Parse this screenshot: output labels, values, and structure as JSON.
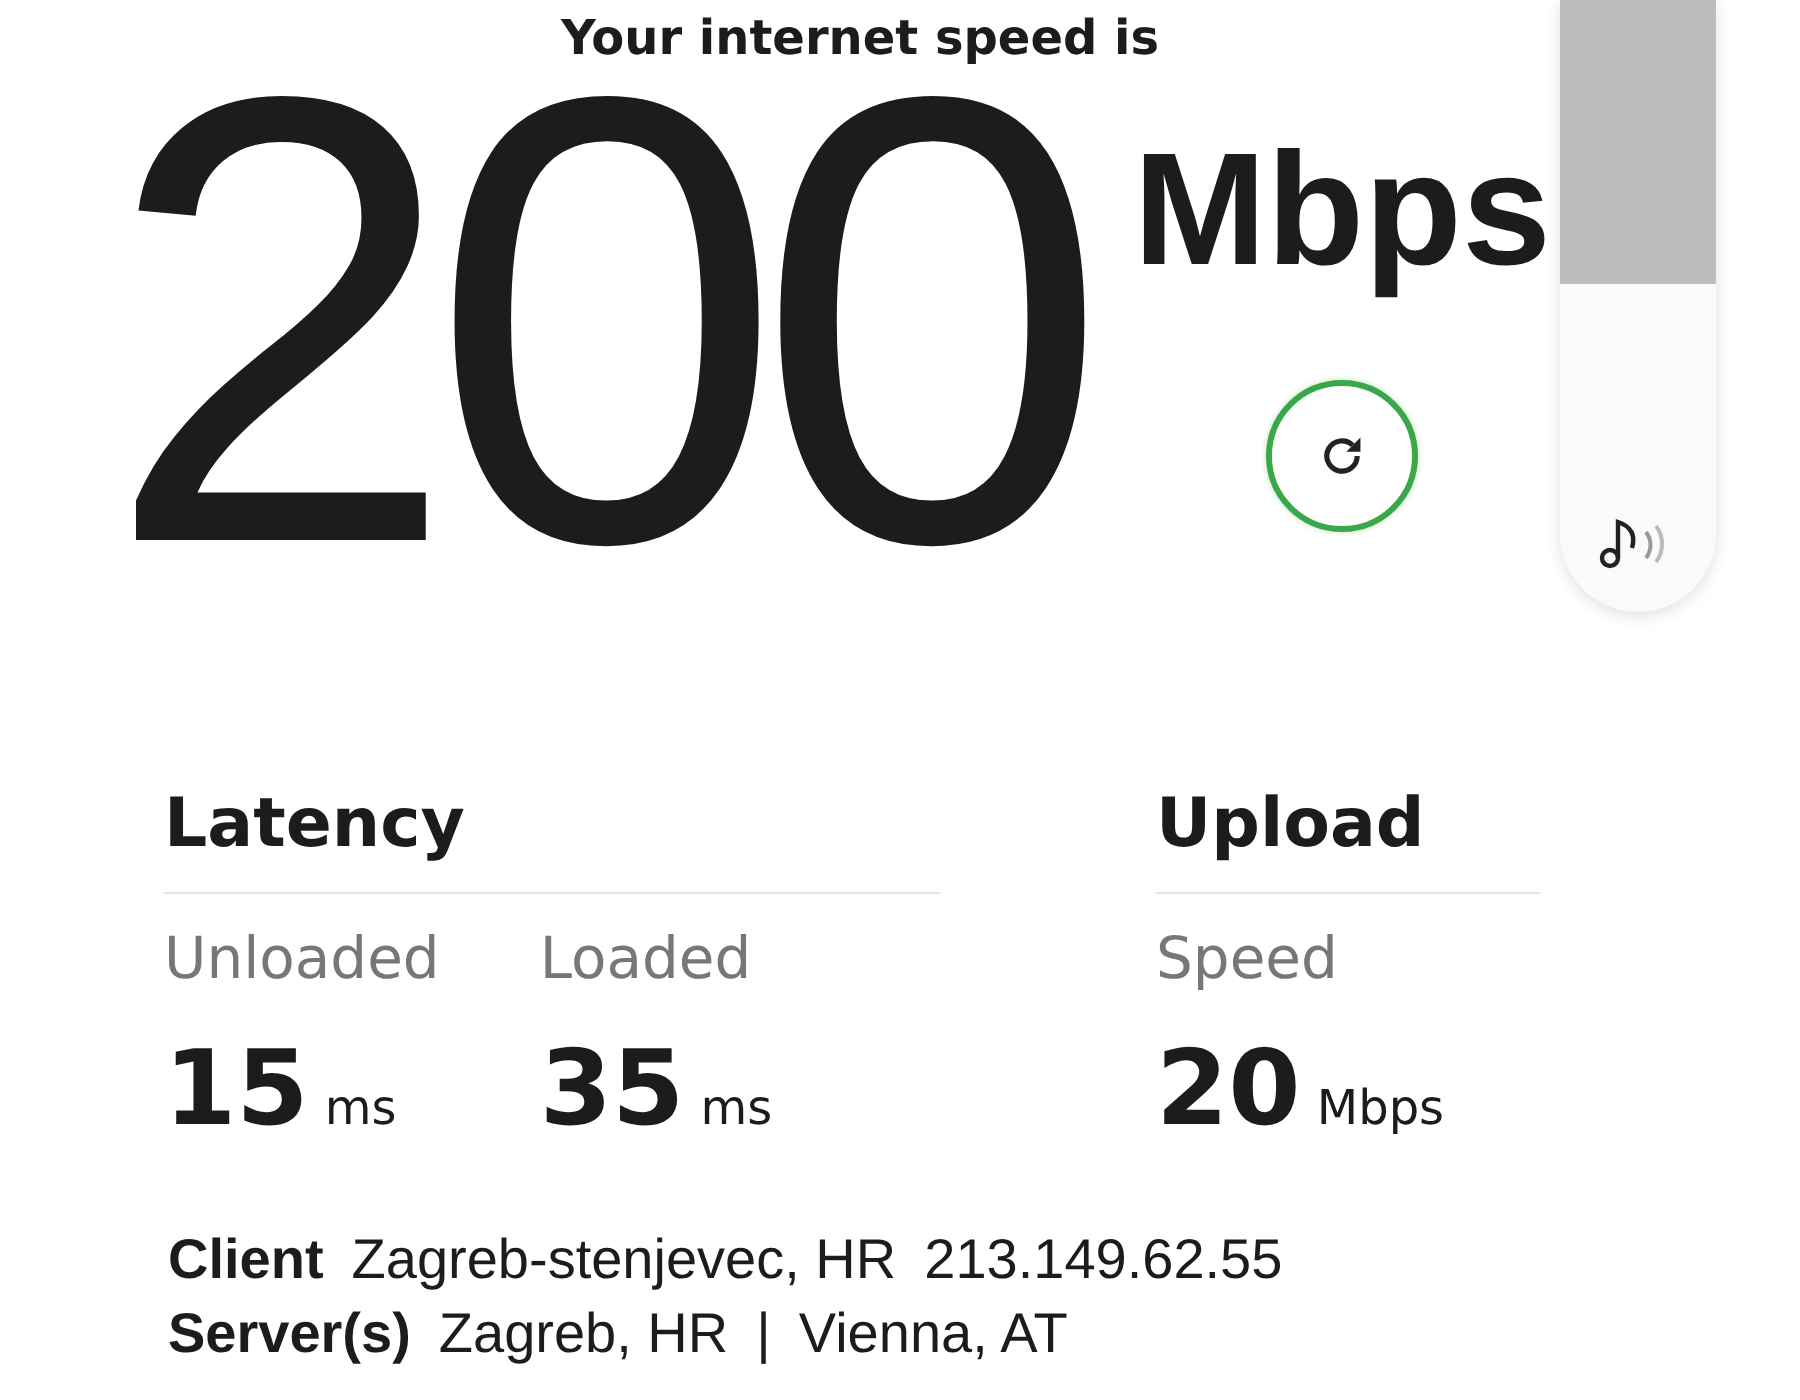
{
  "heading": "Your internet speed is",
  "speed": {
    "value": "200",
    "unit": "Mbps"
  },
  "latency": {
    "title": "Latency",
    "metrics": [
      {
        "label": "Unloaded",
        "value": "15",
        "unit": "ms"
      },
      {
        "label": "Loaded",
        "value": "35",
        "unit": "ms"
      }
    ]
  },
  "upload": {
    "title": "Upload",
    "metrics": [
      {
        "label": "Speed",
        "value": "20",
        "unit": "Mbps"
      }
    ]
  },
  "info": [
    {
      "label": "Client",
      "parts": [
        "Zagreb-stenjevec, HR",
        "213.149.62.55"
      ]
    },
    {
      "label": "Server(s)",
      "parts": [
        "Zagreb, HR",
        "|",
        "Vienna, AT"
      ]
    }
  ]
}
